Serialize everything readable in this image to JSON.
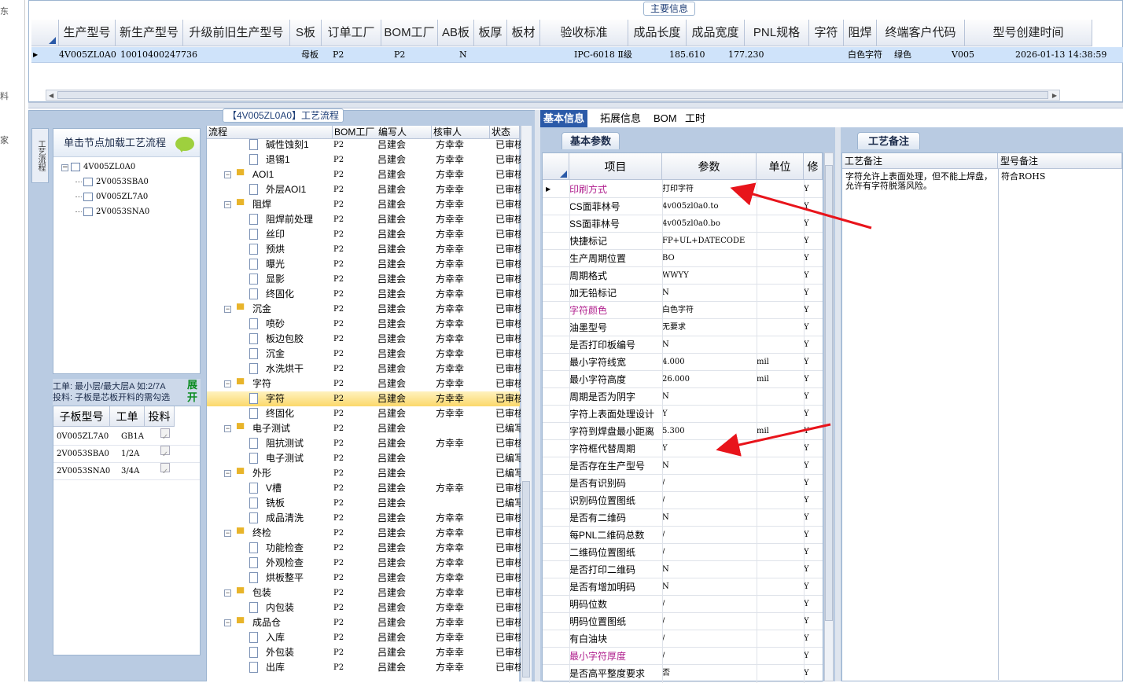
{
  "left_nav": {
    "chars": [
      "东",
      "料",
      "家"
    ]
  },
  "main_info": {
    "title": "主要信息",
    "columns": [
      "生产型号",
      "新生产型号",
      "升级前旧生产型号",
      "S板",
      "订单工厂",
      "BOM工厂",
      "AB板",
      "板厚",
      "板材",
      "验收标准",
      "成品长度",
      "成品宽度",
      "PNL规格",
      "字符",
      "阻焊",
      "终端客户代码",
      "型号创建时间"
    ],
    "row": {
      "model": "4V005ZL0A0",
      "new_model": "10010400247736",
      "sboard": "母板",
      "order_factory": "P2",
      "bom_factory": "P2",
      "ab": "N",
      "standard": "IPC-6018 Ⅱ级",
      "length": "185.610",
      "width": "177.230",
      "legend": "白色字符",
      "solder_mask": "绿色",
      "customer": "V005",
      "created": "2026-01-13 14:38:59"
    }
  },
  "flow": {
    "title": "【4V005ZL0A0】工艺流程",
    "side_tab": "工艺流程",
    "load_hint": "单击节点加载工艺流程",
    "tree_nodes": [
      "4V005ZL0A0",
      "2V0053SBA0",
      "0V005ZL7A0",
      "2V0053SNA0"
    ],
    "info_line1": "工单: 最小层/最大层A  如:2/7A",
    "info_line2": "投料: 子板是芯板开料的需勾选",
    "expand_label": "展开",
    "sub_headers": [
      "子板型号",
      "工单",
      "投料"
    ],
    "sub_rows": [
      {
        "model": "0V005ZL7A0",
        "order": "GB1A"
      },
      {
        "model": "2V0053SBA0",
        "order": "1/2A"
      },
      {
        "model": "2V0053SNA0",
        "order": "3/4A"
      }
    ],
    "grid_headers": [
      "流程",
      "BOM工厂",
      "编写人",
      "核审人",
      "状态"
    ],
    "steps": [
      {
        "name": "碱性蚀刻1",
        "lvl": 2,
        "bom": "P2",
        "writer": "吕建会",
        "reviewer": "方幸幸",
        "status": "已审核"
      },
      {
        "name": "退锡1",
        "lvl": 2,
        "bom": "P2",
        "writer": "吕建会",
        "reviewer": "方幸幸",
        "status": "已审核"
      },
      {
        "name": "AOI1",
        "lvl": 1,
        "bom": "P2",
        "writer": "吕建会",
        "reviewer": "方幸幸",
        "status": "已审核"
      },
      {
        "name": "外层AOI1",
        "lvl": 2,
        "bom": "P2",
        "writer": "吕建会",
        "reviewer": "方幸幸",
        "status": "已审核"
      },
      {
        "name": "阻焊",
        "lvl": 1,
        "bom": "P2",
        "writer": "吕建会",
        "reviewer": "方幸幸",
        "status": "已审核"
      },
      {
        "name": "阻焊前处理",
        "lvl": 2,
        "bom": "P2",
        "writer": "吕建会",
        "reviewer": "方幸幸",
        "status": "已审核"
      },
      {
        "name": "丝印",
        "lvl": 2,
        "bom": "P2",
        "writer": "吕建会",
        "reviewer": "方幸幸",
        "status": "已审核"
      },
      {
        "name": "预烘",
        "lvl": 2,
        "bom": "P2",
        "writer": "吕建会",
        "reviewer": "方幸幸",
        "status": "已审核"
      },
      {
        "name": "曝光",
        "lvl": 2,
        "bom": "P2",
        "writer": "吕建会",
        "reviewer": "方幸幸",
        "status": "已审核"
      },
      {
        "name": "显影",
        "lvl": 2,
        "bom": "P2",
        "writer": "吕建会",
        "reviewer": "方幸幸",
        "status": "已审核"
      },
      {
        "name": "终固化",
        "lvl": 2,
        "bom": "P2",
        "writer": "吕建会",
        "reviewer": "方幸幸",
        "status": "已审核"
      },
      {
        "name": "沉金",
        "lvl": 1,
        "bom": "P2",
        "writer": "吕建会",
        "reviewer": "方幸幸",
        "status": "已审核"
      },
      {
        "name": "喷砂",
        "lvl": 2,
        "bom": "P2",
        "writer": "吕建会",
        "reviewer": "方幸幸",
        "status": "已审核"
      },
      {
        "name": "板边包胶",
        "lvl": 2,
        "bom": "P2",
        "writer": "吕建会",
        "reviewer": "方幸幸",
        "status": "已审核"
      },
      {
        "name": "沉金",
        "lvl": 2,
        "bom": "P2",
        "writer": "吕建会",
        "reviewer": "方幸幸",
        "status": "已审核"
      },
      {
        "name": "水洗烘干",
        "lvl": 2,
        "bom": "P2",
        "writer": "吕建会",
        "reviewer": "方幸幸",
        "status": "已审核"
      },
      {
        "name": "字符",
        "lvl": 1,
        "bom": "P2",
        "writer": "吕建会",
        "reviewer": "方幸幸",
        "status": "已审核"
      },
      {
        "name": "字符",
        "lvl": 2,
        "bom": "P2",
        "writer": "吕建会",
        "reviewer": "方幸幸",
        "status": "已审核",
        "sel": true
      },
      {
        "name": "终固化",
        "lvl": 2,
        "bom": "P2",
        "writer": "吕建会",
        "reviewer": "方幸幸",
        "status": "已审核"
      },
      {
        "name": "电子测试",
        "lvl": 1,
        "bom": "P2",
        "writer": "吕建会",
        "reviewer": "",
        "status": "已编写"
      },
      {
        "name": "阻抗测试",
        "lvl": 2,
        "bom": "P2",
        "writer": "吕建会",
        "reviewer": "方幸幸",
        "status": "已审核"
      },
      {
        "name": "电子测试",
        "lvl": 2,
        "bom": "P2",
        "writer": "吕建会",
        "reviewer": "",
        "status": "已编写"
      },
      {
        "name": "外形",
        "lvl": 1,
        "bom": "P2",
        "writer": "吕建会",
        "reviewer": "",
        "status": "已编写"
      },
      {
        "name": "V槽",
        "lvl": 2,
        "bom": "P2",
        "writer": "吕建会",
        "reviewer": "方幸幸",
        "status": "已审核"
      },
      {
        "name": "铣板",
        "lvl": 2,
        "bom": "P2",
        "writer": "吕建会",
        "reviewer": "",
        "status": "已编写"
      },
      {
        "name": "成品清洗",
        "lvl": 2,
        "bom": "P2",
        "writer": "吕建会",
        "reviewer": "方幸幸",
        "status": "已审核"
      },
      {
        "name": "终检",
        "lvl": 1,
        "bom": "P2",
        "writer": "吕建会",
        "reviewer": "方幸幸",
        "status": "已审核"
      },
      {
        "name": "功能检查",
        "lvl": 2,
        "bom": "P2",
        "writer": "吕建会",
        "reviewer": "方幸幸",
        "status": "已审核"
      },
      {
        "name": "外观检查",
        "lvl": 2,
        "bom": "P2",
        "writer": "吕建会",
        "reviewer": "方幸幸",
        "status": "已审核"
      },
      {
        "name": "烘板整平",
        "lvl": 2,
        "bom": "P2",
        "writer": "吕建会",
        "reviewer": "方幸幸",
        "status": "已审核"
      },
      {
        "name": "包装",
        "lvl": 1,
        "bom": "P2",
        "writer": "吕建会",
        "reviewer": "方幸幸",
        "status": "已审核"
      },
      {
        "name": "内包装",
        "lvl": 2,
        "bom": "P2",
        "writer": "吕建会",
        "reviewer": "方幸幸",
        "status": "已审核"
      },
      {
        "name": "成品仓",
        "lvl": 1,
        "bom": "P2",
        "writer": "吕建会",
        "reviewer": "方幸幸",
        "status": "已审核"
      },
      {
        "name": "入库",
        "lvl": 2,
        "bom": "P2",
        "writer": "吕建会",
        "reviewer": "方幸幸",
        "status": "已审核"
      },
      {
        "name": "外包装",
        "lvl": 2,
        "bom": "P2",
        "writer": "吕建会",
        "reviewer": "方幸幸",
        "status": "已审核"
      },
      {
        "name": "出库",
        "lvl": 2,
        "bom": "P2",
        "writer": "吕建会",
        "reviewer": "方幸幸",
        "status": "已审核"
      }
    ]
  },
  "tabs": [
    "基本信息",
    "拓展信息",
    "BOM",
    "工时"
  ],
  "params": {
    "subtab": "基本参数",
    "headers": [
      "项目",
      "参数",
      "单位",
      "修"
    ],
    "rows": [
      {
        "name": "印刷方式",
        "value": "打印字符",
        "unit": "",
        "mod": "Y",
        "hl": true,
        "sel": true
      },
      {
        "name": "CS面菲林号",
        "value": "4v005zl0a0.to",
        "unit": "",
        "mod": "Y"
      },
      {
        "name": "SS面菲林号",
        "value": "4v005zl0a0.bo",
        "unit": "",
        "mod": "Y"
      },
      {
        "name": "快捷标记",
        "value": "FP+UL+DATECODE",
        "unit": "",
        "mod": "Y"
      },
      {
        "name": "生产周期位置",
        "value": "BO",
        "unit": "",
        "mod": "Y"
      },
      {
        "name": "周期格式",
        "value": "WWYY",
        "unit": "",
        "mod": "Y"
      },
      {
        "name": "加无铅标记",
        "value": "N",
        "unit": "",
        "mod": "Y"
      },
      {
        "name": "字符颜色",
        "value": "白色字符",
        "unit": "",
        "mod": "Y",
        "hl": true
      },
      {
        "name": "油墨型号",
        "value": "无要求",
        "unit": "",
        "mod": "Y"
      },
      {
        "name": "是否打印板编号",
        "value": "N",
        "unit": "",
        "mod": "Y"
      },
      {
        "name": "最小字符线宽",
        "value": "4.000",
        "unit": "mil",
        "mod": "Y"
      },
      {
        "name": "最小字符高度",
        "value": "26.000",
        "unit": "mil",
        "mod": "Y"
      },
      {
        "name": "周期是否为阴字",
        "value": "N",
        "unit": "",
        "mod": "Y"
      },
      {
        "name": "字符上表面处理设计",
        "value": "Y",
        "unit": "",
        "mod": "Y"
      },
      {
        "name": "字符到焊盘最小距离",
        "value": "5.300",
        "unit": "mil",
        "mod": "Y"
      },
      {
        "name": "字符框代替周期",
        "value": "Y",
        "unit": "",
        "mod": "Y"
      },
      {
        "name": "是否存在生产型号",
        "value": "N",
        "unit": "",
        "mod": "Y"
      },
      {
        "name": "是否有识别码",
        "value": "/",
        "unit": "",
        "mod": "Y"
      },
      {
        "name": "识别码位置图纸",
        "value": "/",
        "unit": "",
        "mod": "Y"
      },
      {
        "name": "是否有二维码",
        "value": "N",
        "unit": "",
        "mod": "Y"
      },
      {
        "name": "每PNL二维码总数",
        "value": "/",
        "unit": "",
        "mod": "Y"
      },
      {
        "name": "二维码位置图纸",
        "value": "/",
        "unit": "",
        "mod": "Y"
      },
      {
        "name": "是否打印二维码",
        "value": "N",
        "unit": "",
        "mod": "Y"
      },
      {
        "name": "是否有增加明码",
        "value": "N",
        "unit": "",
        "mod": "Y"
      },
      {
        "name": "明码位数",
        "value": "/",
        "unit": "",
        "mod": "Y"
      },
      {
        "name": "明码位置图纸",
        "value": "/",
        "unit": "",
        "mod": "Y"
      },
      {
        "name": "有白油块",
        "value": "/",
        "unit": "",
        "mod": "Y"
      },
      {
        "name": "最小字符厚度",
        "value": "/",
        "unit": "",
        "mod": "Y",
        "hl": true
      },
      {
        "name": "是否高平整度要求",
        "value": "否",
        "unit": "",
        "mod": "Y"
      }
    ]
  },
  "remarks": {
    "subtab": "工艺备注",
    "col1": "工艺备注",
    "col2": "型号备注",
    "process_note": "字符允许上表面处理，但不能上焊盘，允许有字符脱落风险。",
    "model_note": "符合ROHS"
  },
  "colors": {
    "highlight": "#b0208e",
    "arrow": "#e8141b",
    "tab_active": "#2b5aa8",
    "selection": "#cfe3fa",
    "row_sel": "#fbd86a"
  }
}
